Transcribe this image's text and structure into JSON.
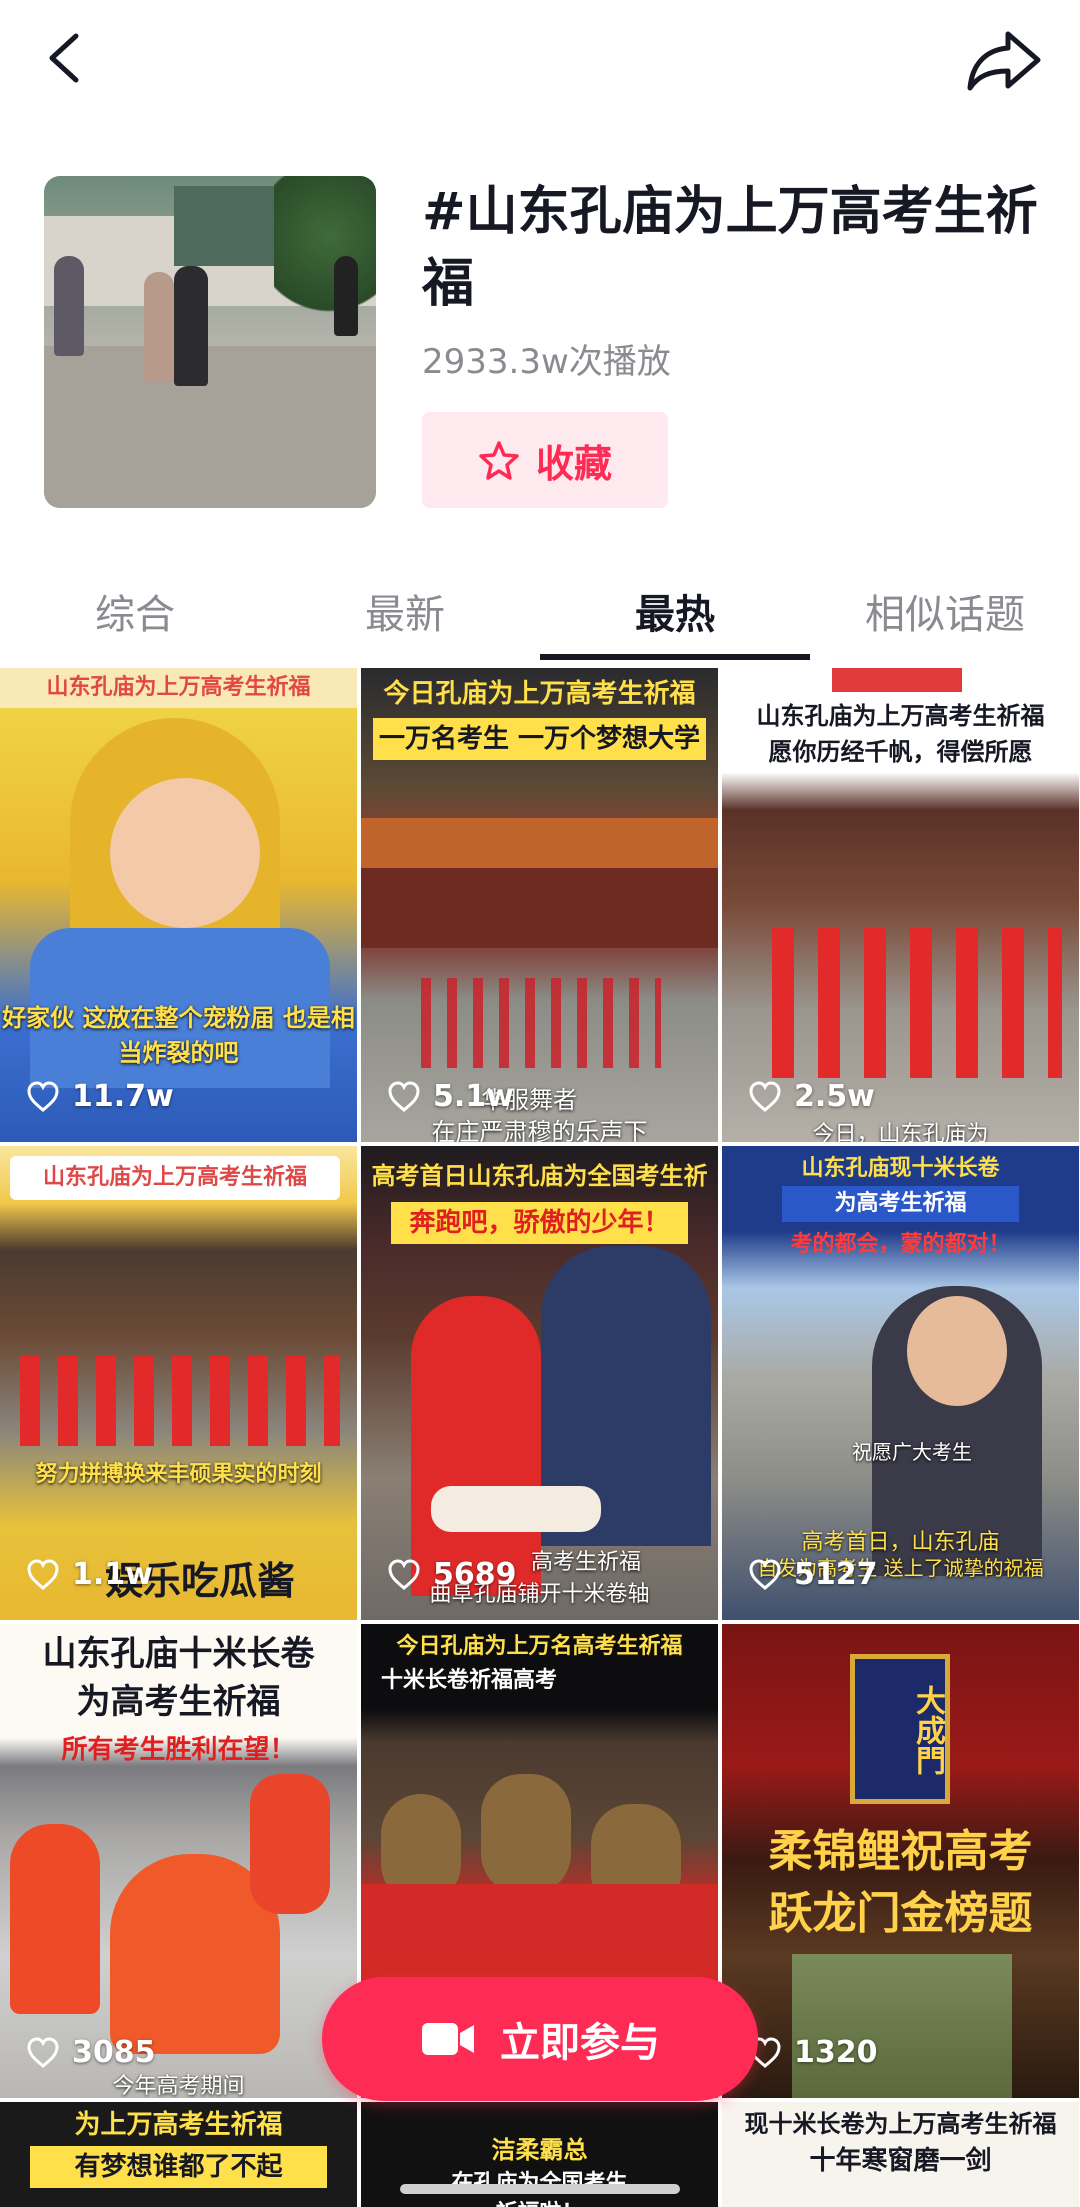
{
  "topic": {
    "title": "#山东孔庙为上万高考生祈福",
    "plays": "2933.3w次播放",
    "favorite_label": "收藏"
  },
  "tabs": [
    {
      "label": "综合",
      "active": false
    },
    {
      "label": "最新",
      "active": false
    },
    {
      "label": "最热",
      "active": true
    },
    {
      "label": "相似话题",
      "active": false
    }
  ],
  "videos": [
    {
      "caption_top": "山东孔庙为上万高考生祈福",
      "caption_mid": "好家伙 这放在整个宠粉届 也是相当炸裂的吧",
      "likes": "11.7w"
    },
    {
      "caption_top": "今日孔庙为上万高考生祈福",
      "caption_sub": "一万名考生 一万个梦想大学",
      "caption_bottom": "在庄严肃穆的乐声下",
      "caption_overlay": "华服舞者",
      "likes": "5.1w"
    },
    {
      "caption_top": "山东孔庙为上万高考生祈福",
      "caption_sub": "愿你历经千帆，得偿所愿",
      "caption_bottom": "今日，山东孔庙为",
      "likes": "2.5w"
    },
    {
      "caption_top": "山东孔庙为上万高考生祈福",
      "caption_mid": "努力拼搏换来丰硕果实的时刻",
      "caption_bottom": "娱乐吃瓜酱",
      "likes": "1.1w"
    },
    {
      "caption_top": "高考首日山东孔庙为全国考生祈福",
      "caption_sub": "奔跑吧，骄傲的少年！",
      "caption_bottom": "曲阜孔庙铺开十米卷轴",
      "caption_overlay": "高考生祈福",
      "likes": "5689"
    },
    {
      "caption_top": "山东孔庙现十米长卷",
      "caption_sub": "为高考生祈福",
      "caption_third": "考的都会，蒙的都对！",
      "caption_mid": "祝愿广大考生",
      "caption_bottom": "高考首日，山东孔庙",
      "caption_overlay": "自发为高考生 送上了诚挚的祝福",
      "likes": "5127"
    },
    {
      "caption_top": "山东孔庙十米长卷",
      "caption_sub": "为高考生祈福",
      "caption_third": "所有考生胜利在望！",
      "caption_bottom": "今年高考期间",
      "likes": "3085"
    },
    {
      "caption_top": "今日孔庙为上万名高考生祈福",
      "caption_sub": "十米长卷祈福高考",
      "likes": ""
    },
    {
      "caption_top": "大成門",
      "caption_sub": "柔锦鲤祝高考",
      "caption_third": "跃龙门金榜题",
      "likes": "1320"
    },
    {
      "caption_top": "为上万高考生祈福",
      "caption_sub": "有梦想谁都了不起",
      "likes": ""
    },
    {
      "caption_top": "洁柔霸总",
      "caption_sub": "在孔庙为全国考生",
      "caption_third": "祈福啦！",
      "likes": ""
    },
    {
      "caption_top": "现十米长卷为上万高考生祈福",
      "caption_sub": "十年寒窗磨一剑",
      "likes": ""
    }
  ],
  "join_button": {
    "label": "立即参与"
  },
  "colors": {
    "accent": "#fe2c55",
    "favorite_bg": "#fde9ee",
    "muted": "#8a8b91",
    "text": "#161823"
  }
}
